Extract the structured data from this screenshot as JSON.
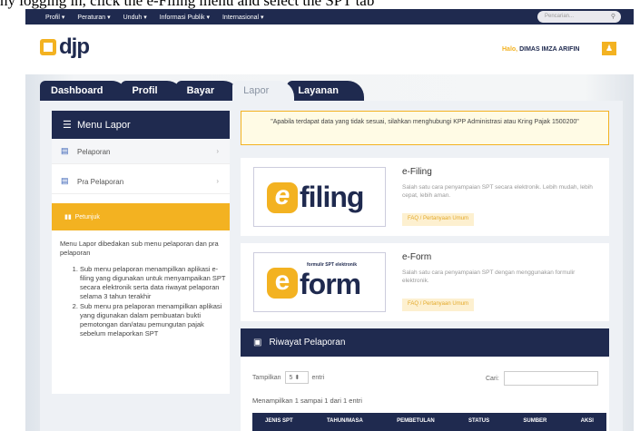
{
  "caption": "ny logging in, click the e-Filing menu and select the SPT tab",
  "topnav": {
    "items": [
      "Profil ▾",
      "Peraturan ▾",
      "Unduh ▾",
      "Informasi Publik ▾",
      "Internasional ▾"
    ],
    "search_placeholder": "Pencarian..."
  },
  "header": {
    "logo_text": "djp",
    "greeting": "Halo,",
    "user_name": "DIMAS IMZA ARIFIN"
  },
  "tabs": [
    {
      "label": "Dashboard",
      "active": false
    },
    {
      "label": "Profil",
      "active": false
    },
    {
      "label": "Bayar",
      "active": false
    },
    {
      "label": "Lapor",
      "active": true
    },
    {
      "label": "Layanan",
      "active": false
    }
  ],
  "sidebar": {
    "title": "Menu Lapor",
    "items": [
      {
        "label": "Pelaporan",
        "chevron": "›"
      },
      {
        "label": "Pra Pelaporan",
        "chevron": "›"
      }
    ],
    "petunjuk_label": "Petunjuk",
    "intro": "Menu Lapor dibedakan sub menu pelaporan dan pra pelaporan",
    "steps": [
      "Sub menu pelaporan menampilkan aplikasi e-filing yang digunakan untuk menyampaikan SPT secara elektronik serta data riwayat pelaporan selama 3 tahun terakhir",
      "Sub menu pra pelaporan menampilkan aplikasi yang digunakan dalam pembuatan bukti pemotongan dan/atau pemungutan pajak sebelum melaporkan SPT"
    ]
  },
  "notice": "\"Apabila terdapat data yang tidak sesuai, silahkan menghubungi KPP Administrasi atau Kring Pajak 1500200\"",
  "efiling": {
    "logo_letter": "e",
    "logo_word": "filing",
    "title": "e-Filing",
    "desc": "Salah satu cara penyampaian SPT secara elektronik. Lebih mudah, lebih cepat, lebih aman.",
    "button": "FAQ / Pertanyaan Umum"
  },
  "eform": {
    "logo_letter": "e",
    "logo_word": "form",
    "logo_tag": "formulir SPT elektronik",
    "title": "e-Form",
    "desc": "Salah satu cara penyampaian SPT dengan menggunakan formulir elektronik.",
    "button": "FAQ / Pertanyaan Umum"
  },
  "riwayat": {
    "title": "Riwayat Pelaporan",
    "show_label": "Tampilkan",
    "page_size": "5",
    "entries_label": "entri",
    "search_label": "Cari:",
    "showing": "Menampilkan 1 sampai 1 dari 1 entri",
    "columns": [
      "JENIS SPT",
      "TAHUN/MASA",
      "PEMBETULAN",
      "STATUS",
      "SUMBER",
      "AKSI"
    ]
  },
  "colors": {
    "navy": "#1f2a4f",
    "accent": "#f3b221"
  }
}
